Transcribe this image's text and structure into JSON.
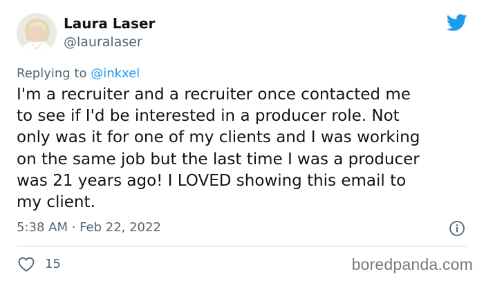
{
  "author": {
    "name": "Laura Laser",
    "handle": "@lauralaser"
  },
  "reply": {
    "prefix": "Replying to ",
    "target": "@inkxel"
  },
  "body_lines": [
    "I'm a recruiter and a recruiter once contacted me",
    "to see if I'd be interested in a producer role. Not",
    "only was it for one of my clients and I was working",
    "on the same job but the last time I was a producer",
    "was 21 years ago! I LOVED showing this email to",
    "my client."
  ],
  "timestamp": "5:38 AM · Feb 22, 2022",
  "likes": "15",
  "watermark": "boredpanda.com",
  "icons": {
    "brand": "twitter-bird-icon",
    "info": "info-icon",
    "like": "heart-icon"
  },
  "colors": {
    "brand": "#1d9bf0",
    "text": "#0f1419",
    "secondary": "#536471",
    "divider": "#cfd9de"
  }
}
